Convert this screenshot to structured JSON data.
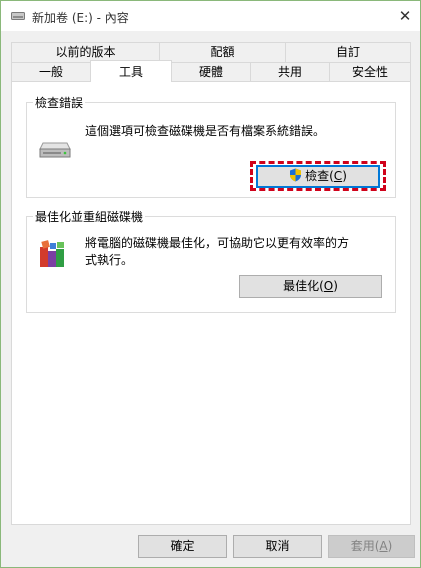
{
  "window": {
    "title": "新加卷 (E:) - 內容",
    "close_glyph": "✕"
  },
  "tabs": {
    "back_row": [
      {
        "label": "以前的版本"
      },
      {
        "label": "配額"
      },
      {
        "label": "自訂"
      }
    ],
    "front_row": [
      {
        "label": "一般"
      },
      {
        "label": "工具",
        "active": true
      },
      {
        "label": "硬體"
      },
      {
        "label": "共用"
      },
      {
        "label": "安全性"
      }
    ]
  },
  "error_check": {
    "title": "檢查錯誤",
    "description": "這個選項可檢查磁碟機是否有檔案系統錯誤。",
    "button_label": "檢查(",
    "button_mnemonic": "C",
    "button_suffix": ")"
  },
  "optimize": {
    "title": "最佳化並重組磁碟機",
    "description": "將電腦的磁碟機最佳化，可協助它以更有效率的方式執行。",
    "button_label": "最佳化(",
    "button_mnemonic": "O",
    "button_suffix": ")"
  },
  "footer": {
    "ok_label": "確定",
    "cancel_label": "取消",
    "apply_label": "套用(",
    "apply_mnemonic": "A",
    "apply_suffix": ")"
  },
  "colors": {
    "highlight": "#d0021b",
    "focus_border": "#0078d7",
    "window_border": "#8ab87a"
  },
  "icons": {
    "title": "drive-icon",
    "close": "close-icon",
    "error_check": "drive-icon",
    "check_button": "uac-shield-icon",
    "optimize": "defrag-icon"
  }
}
